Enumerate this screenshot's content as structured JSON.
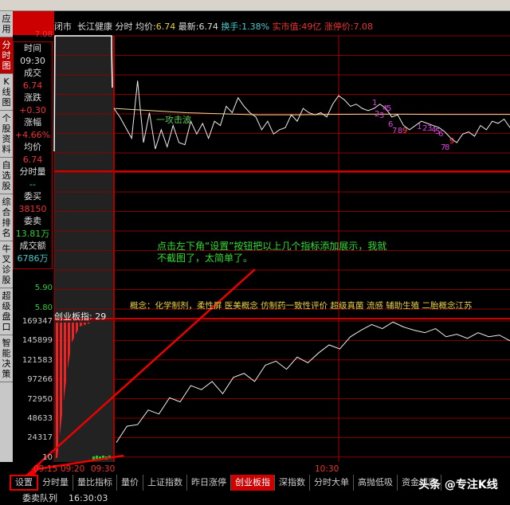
{
  "left_tabs": [
    "应用",
    "分时图",
    "K线图",
    "个股资料",
    "自选股",
    "综合排名",
    "牛叉诊股",
    "超级盘口",
    "智能决策"
  ],
  "active_left_tab": 1,
  "header": {
    "status": "闭市",
    "name": "长江健康",
    "mode": "分时",
    "avg_label": "均价:",
    "avg": "6.74",
    "last_label": "最新:",
    "last": "6.74",
    "turnover_label": "换手:",
    "turnover": "1.38%",
    "mcap_label": "实市值:",
    "mcap": "49亿",
    "limit_label": "涨停价:",
    "limit": "7.08"
  },
  "price_axis": {
    "top": "7.08",
    "l1": "5.90",
    "l2": "5.80"
  },
  "info": {
    "time_l": "时间",
    "time": "09:30",
    "deal_l": "成交",
    "deal": "6.74",
    "chg_l": "涨跌",
    "chg": "+0.30",
    "pct_l": "涨幅",
    "pct": "+4.66%",
    "avg_l": "均价",
    "avg": "6.74",
    "vol_l": "分时量",
    "vol": "--",
    "bid_l": "委买",
    "bid": "38150",
    "ask_l": "委卖",
    "ask": "13.81万",
    "amt_l": "成交额",
    "amt": "6786万"
  },
  "chart_annotation": "一攻击波",
  "signal_marks": [
    "1",
    "2",
    "3",
    "4",
    "5",
    "6",
    "7",
    "8",
    "9",
    "1",
    "2",
    "3",
    "4",
    "5",
    "6",
    "7",
    "8",
    "9"
  ],
  "annotation": "点击左下角“设置”按钮把以上几个指标添加展示，我就不截图了，太简单了。",
  "concept": "概念：化学制剂，柔性屏  医美概念  仿制药一致性评价  超级真菌  流感  辅助生殖  二胎概念江苏",
  "index_label": "创业板指: 29",
  "vol_axis": [
    "169347",
    "145899",
    "121583",
    "97266",
    "72950",
    "48633",
    "24317",
    "10"
  ],
  "times": [
    "09:15",
    "09:20",
    "09:30",
    "10:30"
  ],
  "bottom_tabs": [
    "设置",
    "分时量",
    "量比指标",
    "量价",
    "上证指数",
    "昨日涨停",
    "创业板指",
    "深指数",
    "分时大单",
    "高抛低吸",
    "资金博弈"
  ],
  "active_bottom_tab": 6,
  "status": {
    "label": "委卖队列",
    "time": "16:30:03"
  },
  "watermark": "头条 @专注K线",
  "chart_data": {
    "type": "line",
    "price_series": [
      6.74,
      6.7,
      6.65,
      6.6,
      6.87,
      6.58,
      6.72,
      6.55,
      6.64,
      6.56,
      6.66,
      6.58,
      6.57,
      6.68,
      6.62,
      6.67,
      6.6,
      6.68,
      6.66,
      6.75,
      6.72,
      6.79,
      6.75,
      6.72,
      6.7,
      6.64,
      6.68,
      6.62,
      6.64,
      6.65,
      6.71,
      6.68,
      6.74,
      6.72,
      6.71,
      6.72,
      6.7,
      6.76,
      6.8,
      6.78,
      6.75,
      6.76,
      6.74,
      6.73,
      6.74,
      6.76,
      6.74,
      6.7,
      6.71,
      6.66,
      6.64,
      6.66,
      6.68,
      6.67,
      6.66,
      6.65,
      6.63,
      6.6,
      6.58,
      6.62,
      6.63,
      6.61,
      6.66,
      6.64,
      6.68,
      6.67,
      6.69,
      6.65
    ],
    "avg_series": [
      6.74,
      6.73,
      6.72,
      6.715,
      6.71,
      6.71,
      6.712,
      6.713,
      6.713,
      6.712,
      6.712,
      6.712
    ],
    "index_series": [
      20000,
      40000,
      42000,
      60000,
      55000,
      75000,
      70000,
      90000,
      85000,
      95000,
      80000,
      100000,
      105000,
      95000,
      115000,
      120000,
      110000,
      125000,
      118000,
      130000,
      140000,
      135000,
      150000,
      158000,
      165000,
      160000,
      168000,
      162000,
      158000,
      155000,
      160000,
      150000,
      153000,
      148000,
      155000,
      150000,
      152000,
      145000
    ]
  }
}
